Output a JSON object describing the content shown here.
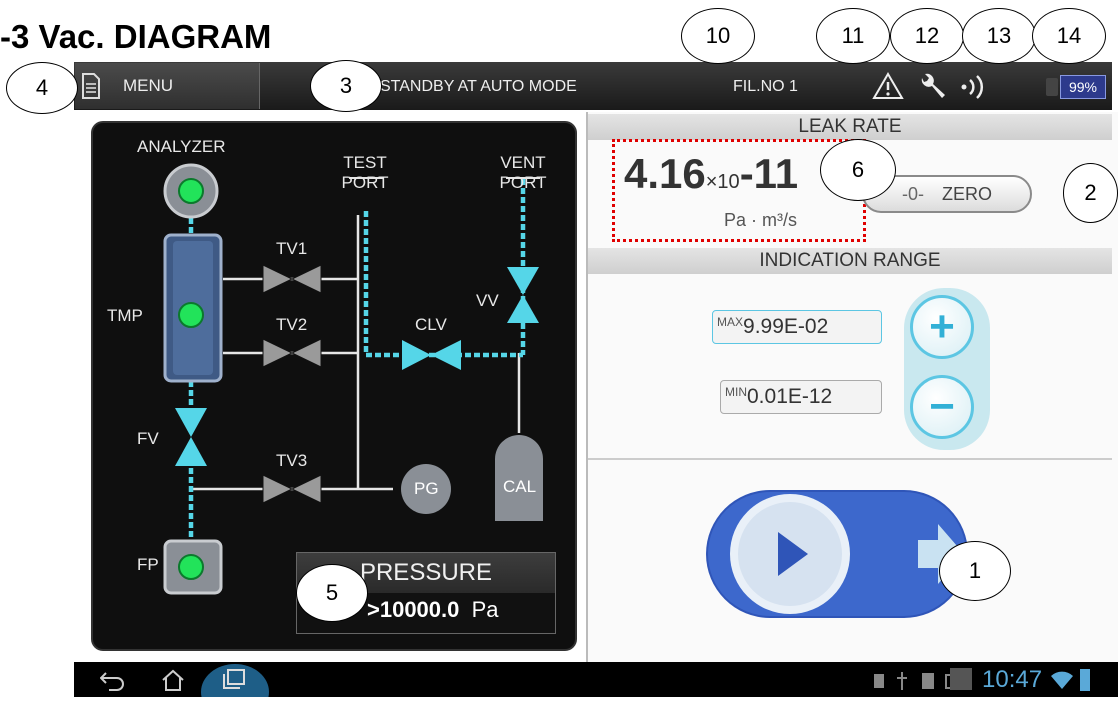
{
  "heading": "-3 Vac. DIAGRAM",
  "callouts": [
    "1",
    "2",
    "3",
    "4",
    "5",
    "6",
    "10",
    "11",
    "12",
    "13",
    "14"
  ],
  "topbar": {
    "menu_label": "MENU",
    "status": "STANDBY AT AUTO MODE",
    "filament": "FIL.NO 1",
    "battery": "99%"
  },
  "diagram": {
    "analyzer": "ANALYZER",
    "test_port_1": "TEST",
    "test_port_2": "PORT",
    "vent_port_1": "VENT",
    "vent_port_2": "PORT",
    "tmp": "TMP",
    "tv1": "TV1",
    "tv2": "TV2",
    "tv3": "TV3",
    "clv": "CLV",
    "vv": "VV",
    "fv": "FV",
    "fp": "FP",
    "pg": "PG",
    "cal": "CAL",
    "pressure_title": "PRESSURE",
    "pressure_value": ">10000.0",
    "pressure_unit": "Pa",
    "colors": {
      "pipe": "#55d6e8",
      "indicator_on": "#22e35a",
      "panel": "#0f0f0f"
    }
  },
  "leak_rate": {
    "title": "LEAK RATE",
    "mantissa": "4.16",
    "multiplier": "×10",
    "exponent": "-11",
    "unit": "Pa · m³/s",
    "zero_symbol": "-0-",
    "zero_label": "ZERO"
  },
  "indication_range": {
    "title": "INDICATION RANGE",
    "max_tag": "MAX",
    "max_value": "9.99E-02",
    "min_tag": "MIN",
    "min_value": "0.01E-12",
    "plus": "+",
    "minus": "−"
  },
  "system_bar": {
    "clock": "10:47"
  }
}
